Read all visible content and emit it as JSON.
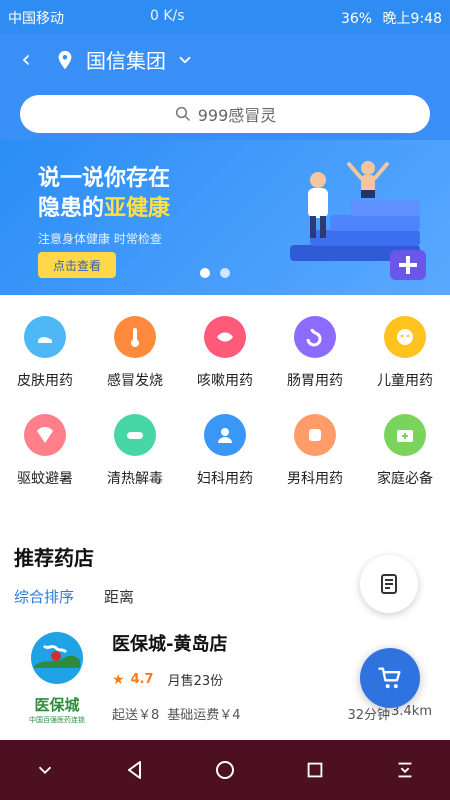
{
  "status_bar": {
    "carrier": "中国移动",
    "speed": "0 K/s",
    "battery": "36%",
    "time": "晚上9:48"
  },
  "header": {
    "location_name": "国信集团",
    "icons": [
      "back-icon",
      "location-pin-icon",
      "chevron-down-icon"
    ]
  },
  "search": {
    "placeholder": "999感冒灵"
  },
  "banner": {
    "headline_part1": "说一说你存在",
    "headline_part2": "隐患的",
    "headline_highlight": "亚健康",
    "subtext": "注意身体健康 时常检查",
    "cta": "点击查看"
  },
  "categories": [
    {
      "label": "皮肤用药",
      "color": "#4db8f5"
    },
    {
      "label": "感冒发烧",
      "color": "#ff8a3d"
    },
    {
      "label": "咳嗽用药",
      "color": "#ff5a7a"
    },
    {
      "label": "肠胃用药",
      "color": "#8d6bff"
    },
    {
      "label": "儿童用药",
      "color": "#ffc21f"
    },
    {
      "label": "驱蚊避暑",
      "color": "#ff7f8a"
    },
    {
      "label": "清热解毒",
      "color": "#47d6a6"
    },
    {
      "label": "妇科用药",
      "color": "#3a97f5"
    },
    {
      "label": "男科用药",
      "color": "#ff9c6a"
    },
    {
      "label": "家庭必备",
      "color": "#7ad35a"
    }
  ],
  "store_section": {
    "title": "推荐药店",
    "sort_options": [
      "综合排序",
      "距离"
    ],
    "store": {
      "name": "医保城-黄岛店",
      "logo_text": "医保城",
      "logo_sub": "中国百强医药连锁",
      "rating": "4.7",
      "monthly_sales": "月售23份",
      "min_order": "起送￥8",
      "delivery_fee": "基础运费￥4",
      "eta": "32分钟",
      "distance": "3.4km"
    }
  },
  "colors": {
    "primary": "#3a8ff7",
    "accent": "#ff7a1a",
    "cart": "#2f73e0",
    "navbar": "#4d1023"
  }
}
